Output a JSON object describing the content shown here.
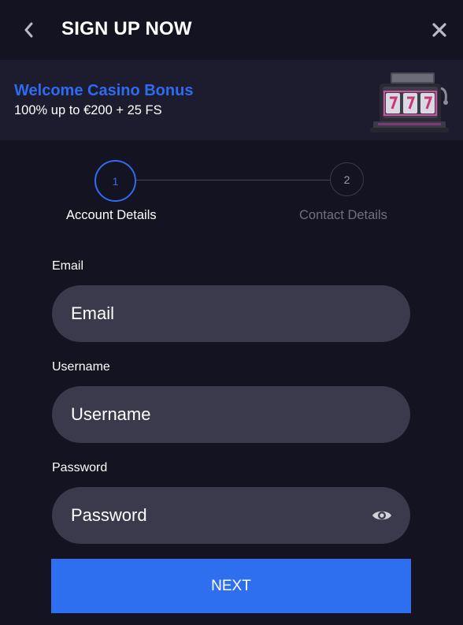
{
  "header": {
    "title": "SIGN UP NOW",
    "back_icon": "chevron-left-icon",
    "close_icon": "close-icon"
  },
  "banner": {
    "title": "Welcome Casino Bonus",
    "subtitle": "100% up to €200 + 25 FS",
    "image_icon": "slot-machine-icon"
  },
  "stepper": {
    "steps": [
      {
        "number": "1",
        "label": "Account Details",
        "active": true
      },
      {
        "number": "2",
        "label": "Contact Details",
        "active": false
      }
    ]
  },
  "form": {
    "email": {
      "label": "Email",
      "placeholder": "Email",
      "value": ""
    },
    "username": {
      "label": "Username",
      "placeholder": "Username",
      "value": ""
    },
    "password": {
      "label": "Password",
      "placeholder": "Password",
      "value": "",
      "toggle_icon": "eye-icon"
    },
    "next_label": "NEXT"
  },
  "colors": {
    "background": "#141321",
    "banner_background": "#1c1c2e",
    "accent": "#2f6bf0",
    "input_background": "#3a3a4c",
    "muted_text": "#6f7082"
  }
}
